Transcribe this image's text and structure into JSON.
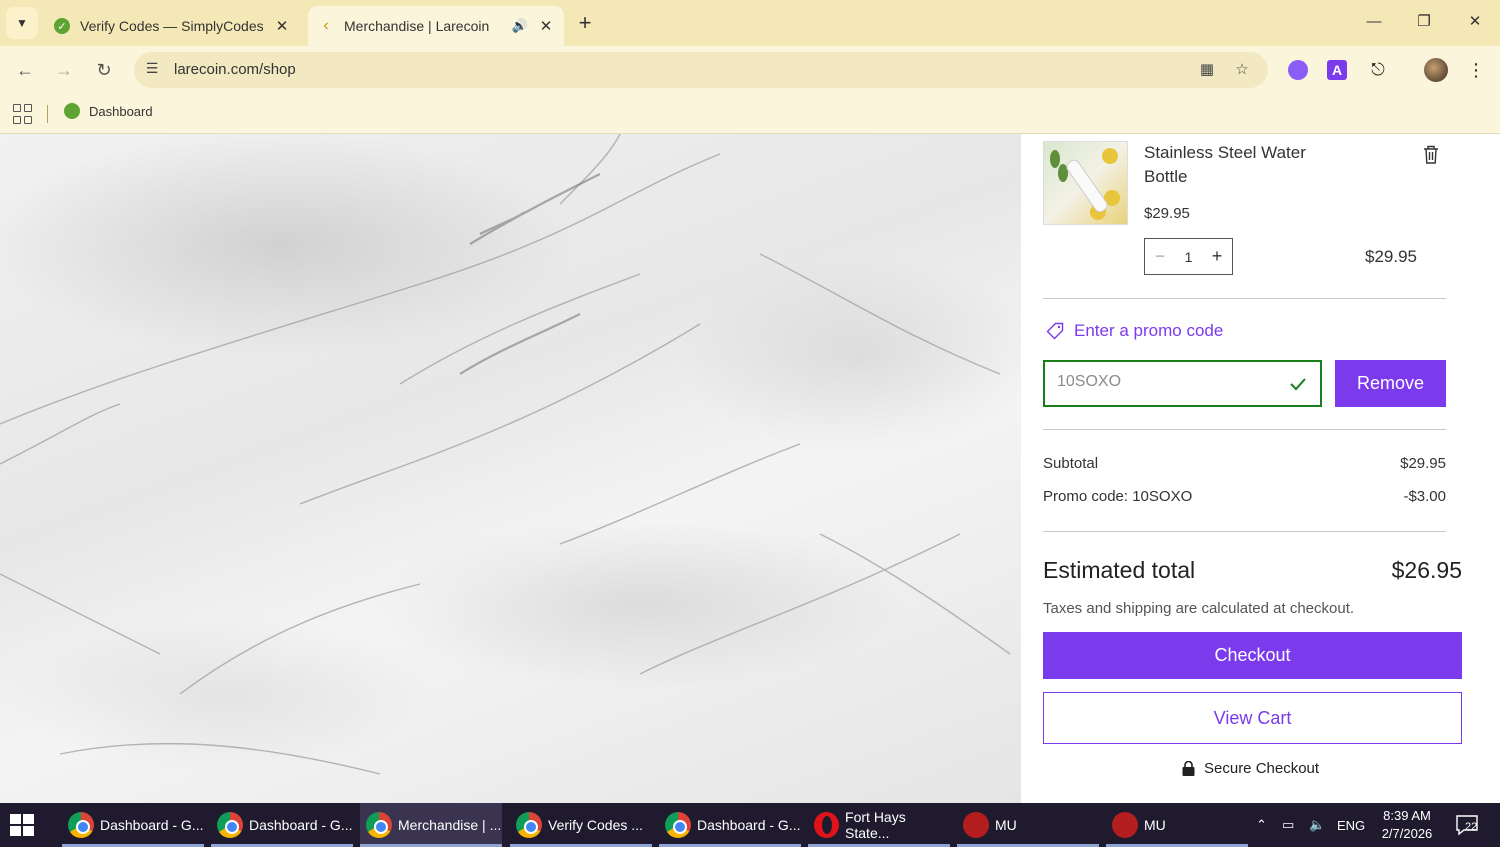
{
  "browser": {
    "tabs": [
      {
        "title": "Verify Codes — SimplyCodes",
        "active": false,
        "favicon_color": "#5da433"
      },
      {
        "title": "Merchandise | Larecoin",
        "active": true,
        "favicon_color": "#c79a00"
      }
    ],
    "url": "larecoin.com/shop",
    "bookmarks": [
      {
        "label": "Dashboard"
      }
    ]
  },
  "cart": {
    "item": {
      "name": "Stainless Steel Water Bottle",
      "unit_price": "$29.95",
      "quantity": "1",
      "line_total": "$29.95"
    },
    "promo_link": "Enter a promo code",
    "promo_code_value": "10SOXO",
    "remove_label": "Remove",
    "subtotal_label": "Subtotal",
    "subtotal_value": "$29.95",
    "promo_label": "Promo code: 10SOXO",
    "promo_value": "-$3.00",
    "total_label": "Estimated total",
    "total_value": "$26.95",
    "tax_note": "Taxes and shipping are calculated at checkout.",
    "checkout_label": "Checkout",
    "view_cart_label": "View Cart",
    "secure_label": "Secure Checkout",
    "accent_color": "#7c3aed"
  },
  "taskbar": {
    "apps": [
      {
        "label": "Dashboard - G...",
        "icon": "chrome-icon"
      },
      {
        "label": "Dashboard - G...",
        "icon": "chrome-icon"
      },
      {
        "label": "Merchandise | ...",
        "icon": "chrome-icon",
        "active": true
      },
      {
        "label": "Verify Codes ...",
        "icon": "chrome-icon"
      },
      {
        "label": "Dashboard - G...",
        "icon": "chrome-icon"
      },
      {
        "label": "Fort Hays State...",
        "icon": "opera-icon"
      },
      {
        "label": "MU",
        "icon": "mu-icon"
      },
      {
        "label": "MU",
        "icon": "mu-icon"
      }
    ],
    "language": "ENG",
    "time": "8:39 AM",
    "date": "2/7/2026",
    "notifications": "22"
  }
}
